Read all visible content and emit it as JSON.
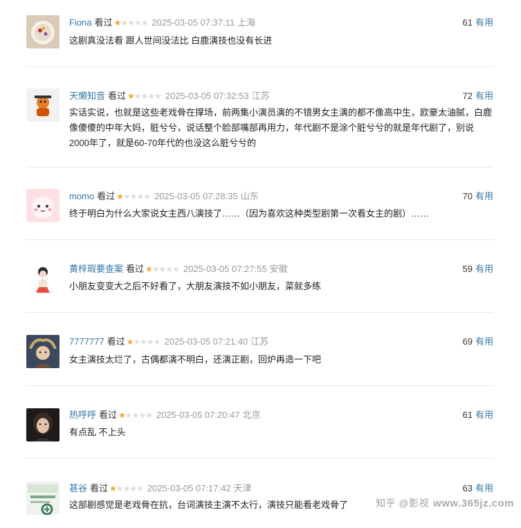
{
  "comments": [
    {
      "user": "Fiona",
      "watched": "看过",
      "rating": 1,
      "time": "2025-03-05 07:37:11",
      "location": "上海",
      "votes": "61",
      "useful": "有用",
      "text": "这剧真没法看 跟人世间没法比 白鹿演技也没有长进"
    },
    {
      "user": "天懒知音",
      "watched": "看过",
      "rating": 1,
      "time": "2025-03-05 07:32:53",
      "location": "江苏",
      "votes": "72",
      "useful": "有用",
      "text": "实话实说，也就是这些老戏骨在撑场，前两集小演员演的不错男女主演的都不像高中生，欧豪太油腻，白鹿像傻傻的中年大妈，脏兮兮，说话整个脸部嘴部再用力，年代剧不是涂个脏兮兮的就是年代剧了，别说2000年了，就是60-70年代的也没这么脏兮兮的"
    },
    {
      "user": "momo",
      "watched": "看过",
      "rating": 1,
      "time": "2025-03-05 07:28:35",
      "location": "山东",
      "votes": "70",
      "useful": "有用",
      "text": "终于明白为什么大家说女主西八演技了……（因为喜欢这种类型剧第一次看女主的剧）……"
    },
    {
      "user": "黄梓瑕要查案",
      "watched": "看过",
      "rating": 1,
      "time": "2025-03-05 07:27:55",
      "location": "安徽",
      "votes": "59",
      "useful": "有用",
      "text": "小朋友变变大之后不好看了，大朋友演技不如小朋友，菜就多练"
    },
    {
      "user": "7777777",
      "watched": "看过",
      "rating": 1,
      "time": "2025-03-05 07:21:40",
      "location": "江苏",
      "votes": "69",
      "useful": "有用",
      "text": "女主演技太烂了，古偶都演不明白，还演正剧，回炉再造一下吧"
    },
    {
      "user": "热呼呼",
      "watched": "看过",
      "rating": 1,
      "time": "2025-03-05 07:20:47",
      "location": "北京",
      "votes": "61",
      "useful": "有用",
      "text": "有点乱 不上头"
    },
    {
      "user": "甚谷",
      "watched": "看过",
      "rating": 1,
      "time": "2025-03-05 07:17:42",
      "location": "天津",
      "votes": "63",
      "useful": "有用",
      "text": "这部剧感觉是老戏骨在抗，台词演技主演不太行，演技只能看老戏骨了"
    }
  ],
  "star_on": "★",
  "star_off": "★",
  "watermark": {
    "text": "知乎 @影视",
    "site": "www.365jz.com"
  },
  "colors": {
    "link": "#3377aa",
    "star": "#f5a623",
    "muted": "#999999"
  }
}
